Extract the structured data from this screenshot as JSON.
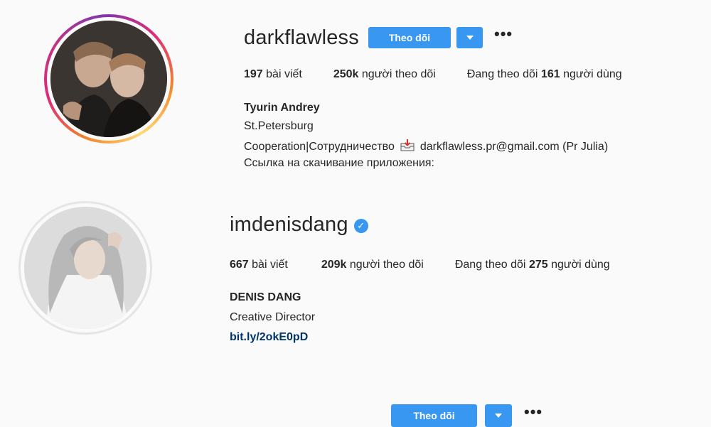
{
  "profiles": [
    {
      "username": "darkflawless",
      "verified": false,
      "follow_label": "Theo dõi",
      "stats": {
        "posts_count": "197",
        "posts_label": "bài viết",
        "followers_count": "250k",
        "followers_label": "người theo dõi",
        "following_prefix": "Đang theo dõi",
        "following_count": "161",
        "following_suffix": "người dùng"
      },
      "bio": {
        "name": "Tyurin Andrey",
        "lines": [
          "St.Petersburg",
          "Cooperation|Сотрудничество",
          "darkflawless.pr@gmail.com (Pr Julia)",
          "Ссылка на скачивание приложения:"
        ]
      }
    },
    {
      "username": "imdenisdang",
      "verified": true,
      "verified_glyph": "✓",
      "follow_label": "Theo dõi",
      "stats": {
        "posts_count": "667",
        "posts_label": "bài viết",
        "followers_count": "209k",
        "followers_label": "người theo dõi",
        "following_prefix": "Đang theo dõi",
        "following_count": "275",
        "following_suffix": "người dùng"
      },
      "bio": {
        "name": "DENIS DANG",
        "lines": [
          "Creative Director"
        ],
        "link": "bit.ly/2okE0pD"
      }
    }
  ],
  "colors": {
    "primary_button": "#3897f0",
    "text": "#262626",
    "link": "#003569",
    "background": "#fafafa"
  }
}
